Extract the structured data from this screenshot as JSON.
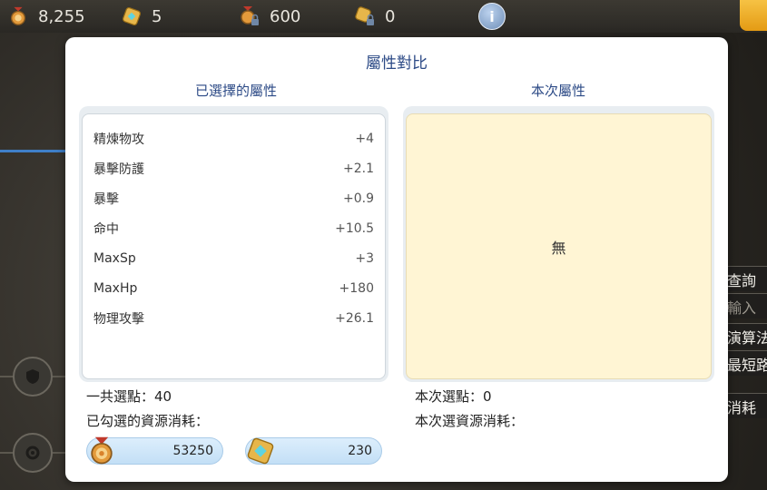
{
  "resources": [
    {
      "icon": "medal-icon",
      "value": "8,255"
    },
    {
      "icon": "crystal-box-icon",
      "value": "5"
    },
    {
      "icon": "locked-medal-icon",
      "value": "600"
    },
    {
      "icon": "locked-crystal-icon",
      "value": "0"
    }
  ],
  "info_button": "i",
  "side_menu": [
    {
      "label": "查詢"
    },
    {
      "label": "輸入"
    },
    {
      "label": "演算法"
    },
    {
      "label": "最短路"
    },
    {
      "label": "消耗"
    }
  ],
  "dialog": {
    "title": "屬性對比",
    "left_header": "已選擇的屬性",
    "right_header": "本次屬性",
    "attributes": [
      {
        "name": "精煉物攻",
        "value": "+4"
      },
      {
        "name": "暴擊防護",
        "value": "+2.1"
      },
      {
        "name": "暴擊",
        "value": "+0.9"
      },
      {
        "name": "命中",
        "value": "+10.5"
      },
      {
        "name": "MaxSp",
        "value": "+3"
      },
      {
        "name": "MaxHp",
        "value": "+180"
      },
      {
        "name": "物理攻擊",
        "value": "+26.1"
      }
    ],
    "empty_text": "無",
    "total_points": "一共選點：40",
    "selected_cost_label": "已勾選的資源消耗：",
    "current_points": "本次選點：0",
    "current_cost_label": "本次選資源消耗：",
    "costs": [
      {
        "icon": "medal-icon",
        "value": "53250"
      },
      {
        "icon": "crystal-box-icon",
        "value": "230"
      }
    ]
  },
  "colors": {
    "title_blue": "#2c4a86",
    "empty_panel": "#fff5d4",
    "pill_blue": "#c3dff6"
  }
}
